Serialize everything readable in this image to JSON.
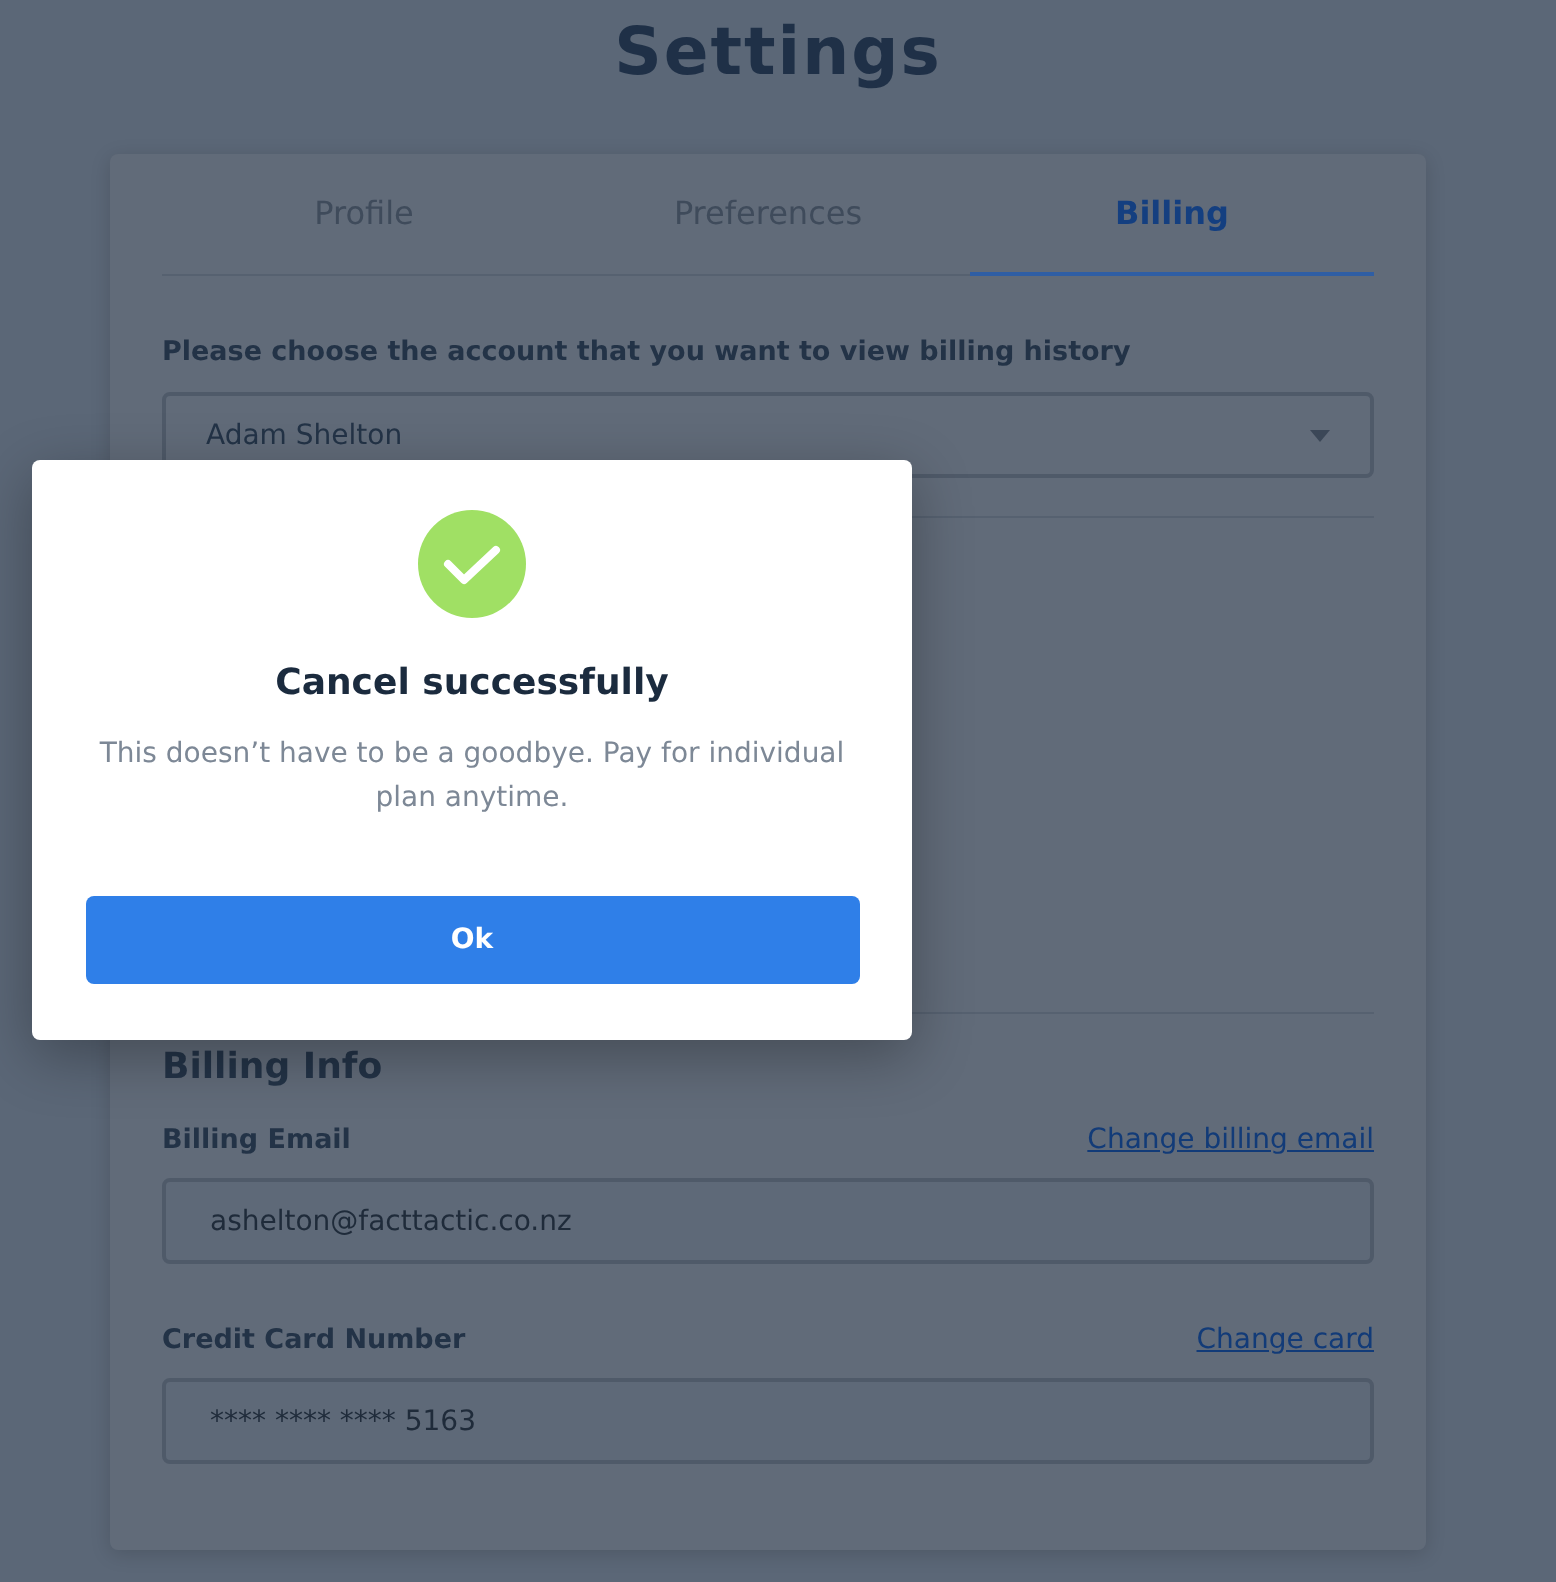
{
  "page": {
    "title": "Settings"
  },
  "tabs": [
    {
      "label": "Profile",
      "selected": false
    },
    {
      "label": "Preferences",
      "selected": false
    },
    {
      "label": "Billing",
      "selected": true
    }
  ],
  "account": {
    "label": "Please choose the account that you want to view billing history",
    "value": "Adam Shelton"
  },
  "billing_info": {
    "heading": "Billing Info",
    "fields": [
      {
        "label": "Billing Email",
        "link": "Change billing email",
        "value": "ashelton@facttactic.co.nz"
      },
      {
        "label": "Credit Card Number",
        "link": "Change card",
        "value": "**** **** **** 5163"
      }
    ]
  },
  "dialog": {
    "title": "Cancel successfully",
    "message": "This doesn’t have to be a goodbye. Pay for individual plan anytime.",
    "button": "Ok"
  }
}
